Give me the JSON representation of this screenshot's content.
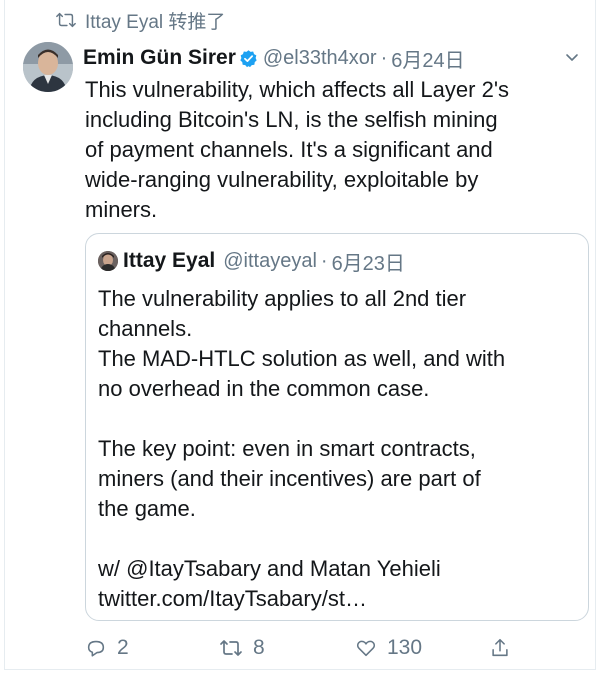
{
  "retweet_context": {
    "text": "Ittay Eyal 转推了",
    "icon": "retweet-icon"
  },
  "tweet": {
    "author_name": "Emin Gün Sirer",
    "verified_icon": "verified-badge-icon",
    "handle": "@el33th4xor",
    "separator": "·",
    "date": "6月24日",
    "menu_icon": "chevron-down-icon",
    "text_lines": [
      "This vulnerability, which affects all Layer 2's",
      "including Bitcoin's LN, is the selfish mining",
      "of payment channels. It's a significant and",
      "wide-ranging vulnerability, exploitable by",
      "miners."
    ]
  },
  "quoted_tweet": {
    "author_name": "Ittay Eyal",
    "handle": "@ittayeyal",
    "separator": "·",
    "date": "6月23日",
    "text_lines": [
      "The vulnerability applies to all 2nd tier",
      "channels.",
      "The MAD-HTLC solution as well, and with",
      "no overhead in the common case.",
      "",
      "The key point: even in smart contracts,",
      "miners (and their incentives) are part of",
      "the game.",
      "",
      "w/ @ItayTsabary and Matan Yehieli",
      "twitter.com/ItayTsabary/st…"
    ]
  },
  "actions": {
    "reply_count": "2",
    "retweet_count": "8",
    "like_count": "130"
  },
  "colors": {
    "text": "#14171a",
    "secondary": "#657786",
    "border": "#ccd6dd",
    "verified": "#1da1f2"
  }
}
